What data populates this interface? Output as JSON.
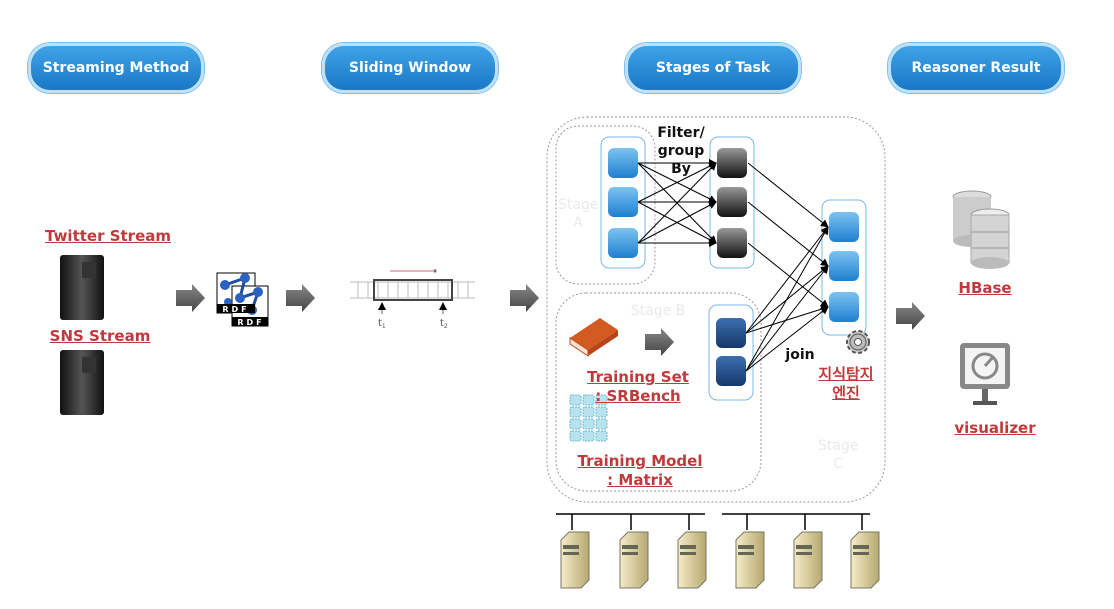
{
  "headers": [
    "Streaming Method",
    "Sliding Window",
    "Stages of Task",
    "Reasoner Result"
  ],
  "sources": {
    "twitter": "Twitter Stream",
    "sns": "SNS Stream"
  },
  "rdf_icon": {
    "text": "RDF"
  },
  "window": {
    "t1": "t",
    "t1_sub": "1",
    "t2": "t",
    "t2_sub": "2"
  },
  "stages": {
    "stage_a": "Stage A",
    "stage_b": "Stage B",
    "stage_c": "Stage C",
    "filter_label": "Filter/ group By",
    "join_label": "join",
    "training_set": "Training Set : SRBench",
    "training_model": "Training Model : Matrix",
    "engine": "지식탐지 엔진"
  },
  "results": {
    "hbase": "HBase",
    "visualizer": "visualizer"
  },
  "colors": {
    "pill": "#1f82cf",
    "link": "#c0393b",
    "node_light": "#3a95dc",
    "node_dark": "#333333",
    "node_navy": "#1f4f8a"
  }
}
